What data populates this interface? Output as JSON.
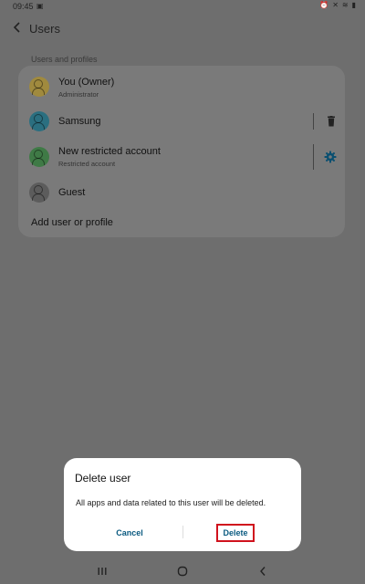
{
  "status_bar": {
    "time": "09:45",
    "gallery_icon": "image-icon",
    "icons": [
      "alarm-icon",
      "mute-icon",
      "wifi-icon",
      "battery-icon"
    ]
  },
  "header": {
    "title": "Users",
    "back_icon": "back-arrow-icon"
  },
  "users_section": {
    "label": "Users and profiles",
    "items": [
      {
        "name": "You (Owner)",
        "subtitle": "Administrator",
        "avatar_color": "#a08a3e"
      },
      {
        "name": "Samsung",
        "subtitle": "",
        "avatar_color": "#2b6f80",
        "action_icon": "trash-icon"
      },
      {
        "name": "New restricted account",
        "subtitle": "Restricted account",
        "avatar_color": "#3f7a46",
        "action_icon": "gear-icon"
      },
      {
        "name": "Guest",
        "subtitle": "",
        "avatar_color": "#5c5c5c"
      }
    ],
    "add_label": "Add user or profile"
  },
  "dialog": {
    "title": "Delete user",
    "message": "All apps and data related to this user will be deleted.",
    "cancel_label": "Cancel",
    "delete_label": "Delete"
  },
  "nav_bar": {
    "items": [
      "recents-icon",
      "home-icon",
      "back-icon"
    ]
  },
  "colors": {
    "dim_background": "#6e6e6e",
    "card": "#7a7a7a",
    "accent": "#0a5a80",
    "highlight": "#d0121d"
  }
}
